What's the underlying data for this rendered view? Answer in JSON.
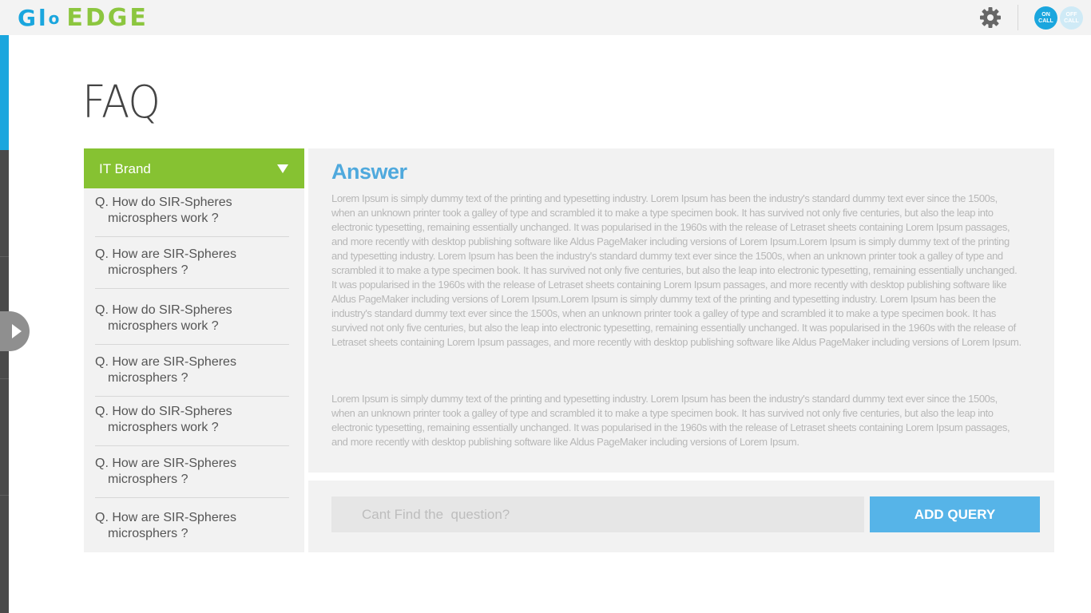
{
  "header": {
    "logo_glo": "Gl",
    "logo_o": "o",
    "logo_edge": "EDGE",
    "settings_icon": "gear-icon",
    "on_call_line1": "ON",
    "on_call_line2": "CALL",
    "off_call_line1": "OFF",
    "off_call_line2": "CALL"
  },
  "colors": {
    "brand_blue": "#1aa6de",
    "brand_green": "#86c232",
    "button_blue": "#56b4e8",
    "answer_title": "#4fa9dd"
  },
  "page": {
    "title": "FAQ"
  },
  "questions": {
    "dropdown_label": "IT Brand",
    "items": [
      {
        "line1": "Q. How do SIR-Spheres",
        "line2": "microsphers work ?"
      },
      {
        "line1": "Q. How are SIR-Spheres",
        "line2": "microsphers ?"
      },
      {
        "line1": "Q. How do SIR-Spheres",
        "line2": "microsphers work ?"
      },
      {
        "line1": "Q. How are SIR-Spheres",
        "line2": "microsphers ?"
      },
      {
        "line1": "Q. How do SIR-Spheres",
        "line2": "microsphers work ?"
      },
      {
        "line1": "Q. How are SIR-Spheres",
        "line2": "microsphers ?"
      },
      {
        "line1": "Q. How are SIR-Spheres",
        "line2": "microsphers ?"
      }
    ]
  },
  "answer": {
    "title": "Answer",
    "paragraph1": "Lorem Ipsum is simply dummy text of the printing and typesetting industry. Lorem Ipsum has been the industry's standard dummy text ever since the 1500s, when an unknown printer took a galley of type and scrambled it to make a type specimen book. It has survived not only five centuries, but also the leap into electronic typesetting, remaining essentially unchanged. It was popularised in the 1960s with the release of Letraset sheets containing Lorem Ipsum passages, and more recently with desktop publishing software like Aldus PageMaker including versions of Lorem Ipsum.Lorem Ipsum is simply dummy text of the printing and typesetting industry. Lorem Ipsum has been the industry's standard dummy text ever since the 1500s, when an unknown printer took a galley of type and scrambled it to make a type specimen book. It has survived not only five centuries, but also the leap into electronic typesetting, remaining essentially unchanged. It was popularised in the 1960s with the release of Letraset sheets containing Lorem Ipsum passages, and more recently with desktop publishing software like Aldus PageMaker including versions of Lorem Ipsum.Lorem Ipsum is simply dummy text of the printing and typesetting industry. Lorem Ipsum has been the industry's standard dummy text ever since the 1500s, when an unknown printer took a galley of type and scrambled it to make a type specimen book. It has survived not only five centuries, but also the leap into electronic typesetting, remaining essentially unchanged. It was popularised in the 1960s with the release of Letraset sheets containing Lorem Ipsum passages, and more recently with desktop publishing software like Aldus PageMaker including versions of Lorem Ipsum.",
    "paragraph2": "Lorem Ipsum is simply dummy text of the printing and typesetting industry. Lorem Ipsum has been the industry's standard dummy text ever since the 1500s, when an unknown printer took a galley of type and scrambled it to make a type specimen book. It has survived not only five centuries, but also the leap into electronic typesetting, remaining essentially unchanged. It was popularised in the 1960s with the release of Letraset sheets containing Lorem Ipsum passages, and more recently with desktop publishing software like Aldus PageMaker including versions of Lorem Ipsum."
  },
  "query": {
    "placeholder": "Cant Find the  question?",
    "value": "",
    "button_label": "ADD QUERY"
  },
  "sidebar": {
    "expand_icon": "play-arrow-icon"
  }
}
